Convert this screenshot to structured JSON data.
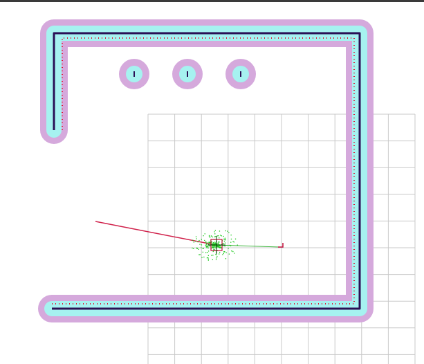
{
  "app": {
    "view": "rviz-map-display"
  },
  "colors": {
    "background": "#ffffff",
    "toolbar": "#3a3a3a",
    "inflation_outer": "#d5a9dc",
    "inflation_inner": "#a6f2f0",
    "obstacle": "#2a1055",
    "laser_scan": "#e01030",
    "grid_line": "#c8c8c8",
    "particle_cloud": "#1cc81c",
    "global_path": "#d0204a",
    "local_path": "#3cb43c",
    "robot_footprint": "#c0103a",
    "robot_marker": "#0a3a0a"
  },
  "icons": {
    "robot": "robot-marker-icon",
    "goal": "goal-marker-icon"
  }
}
